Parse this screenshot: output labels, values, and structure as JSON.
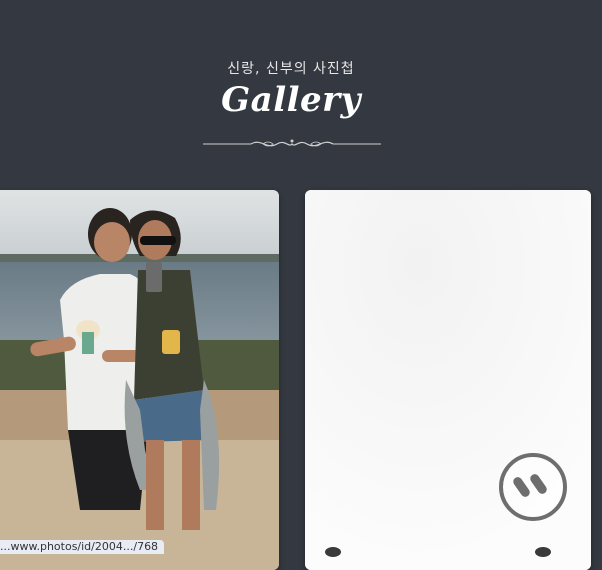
{
  "header": {
    "subtitle": "신랑, 신부의 사진첩",
    "title": "Gallery"
  },
  "gallery": {
    "photos": [
      {
        "alt": "Couple taking a selfie by the sea"
      },
      {
        "alt": "Bright white photo"
      }
    ],
    "pause_button": {
      "icon": "pause-icon"
    }
  },
  "status_bar": {
    "url": "...www.photos/id/2004.../768"
  },
  "colors": {
    "background": "#343840",
    "text": "#ffffff"
  }
}
